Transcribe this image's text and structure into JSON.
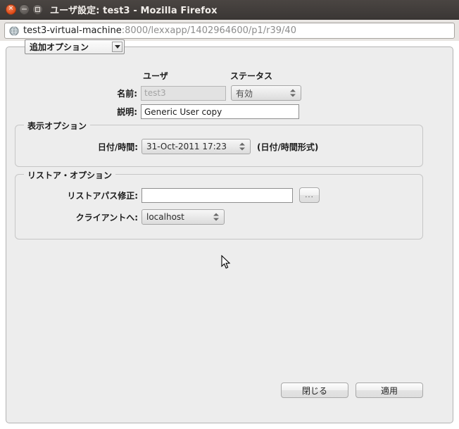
{
  "window": {
    "title": "ユーザ設定: test3 - Mozilla Firefox",
    "controls": {
      "close": "close-button",
      "minimize": "minimize-button",
      "maximize": "maximize-button"
    }
  },
  "urlbar": {
    "icon": "globe-icon",
    "host": "test3-virtual-machine",
    "path": ":8000/lexxapp/1402964600/p1/r39/40"
  },
  "form": {
    "options_combo": {
      "value": "追加オプション"
    },
    "columns": {
      "user": "ユーザ",
      "status": "ステータス"
    },
    "name": {
      "label": "名前:",
      "value": "test3",
      "disabled": true
    },
    "status": {
      "value": "有効"
    },
    "description": {
      "label": "説明:",
      "value": "Generic User copy"
    },
    "display_options": {
      "legend": "表示オプション",
      "datetime": {
        "label": "日付/時間:",
        "value": "31-Oct-2011 17:23",
        "hint": "(日付/時間形式)"
      }
    },
    "restore_options": {
      "legend": "リストア・オプション",
      "restore_path": {
        "label": "リストアパス修正:",
        "value": "",
        "browse_label": "..."
      },
      "to_client": {
        "label": "クライアントへ:",
        "value": "localhost"
      }
    }
  },
  "footer": {
    "close_label": "閉じる",
    "apply_label": "適用"
  },
  "colors": {
    "titlebar": "#3b3735",
    "accent_close": "#dd4814",
    "panel_bg": "#ededed",
    "border": "#c6c6c6"
  }
}
